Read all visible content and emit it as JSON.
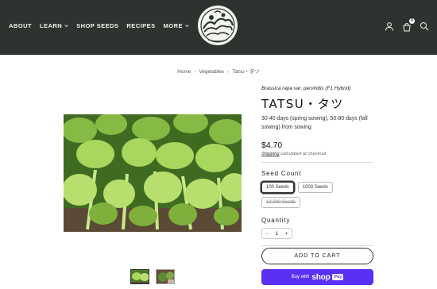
{
  "header": {
    "nav": [
      {
        "label": "ABOUT",
        "dropdown": false
      },
      {
        "label": "LEARN",
        "dropdown": true
      },
      {
        "label": "SHOP SEEDS",
        "dropdown": false
      },
      {
        "label": "RECIPES",
        "dropdown": false
      },
      {
        "label": "MORE",
        "dropdown": true
      }
    ],
    "cart_count": "0",
    "colors": {
      "bg": "#2d3430",
      "text": "#f2f2ee"
    },
    "icons": [
      "user-icon",
      "cart-icon",
      "search-icon"
    ]
  },
  "breadcrumb": {
    "home": "Home",
    "category": "Vegetables",
    "current": "Tatsu・タツ"
  },
  "product": {
    "latin_name": "Brassica rapa var. perviridis (F1 Hybrid)",
    "title": "TATSU・タツ",
    "description": "30-40 days (spring sowing), 50-80 days (fall sowing) from sowing",
    "price": "$4.70",
    "shipping_link": "Shipping",
    "shipping_text": " calculated at checkout",
    "seed_count_label": "Seed Count",
    "seed_options": [
      {
        "label": "100 Seeds",
        "state": "selected"
      },
      {
        "label": "1000 Seeds",
        "state": "available"
      },
      {
        "label": "10,000 Seeds",
        "state": "sold_out"
      }
    ],
    "quantity_label": "Quantity",
    "quantity": {
      "minus": "-",
      "value": "1",
      "plus": "+"
    },
    "add_to_cart": "ADD TO CART",
    "buy_with": "Buy with",
    "shop_word": "shop",
    "pay_word": "Pay",
    "accent_color": "#5a31f4"
  }
}
